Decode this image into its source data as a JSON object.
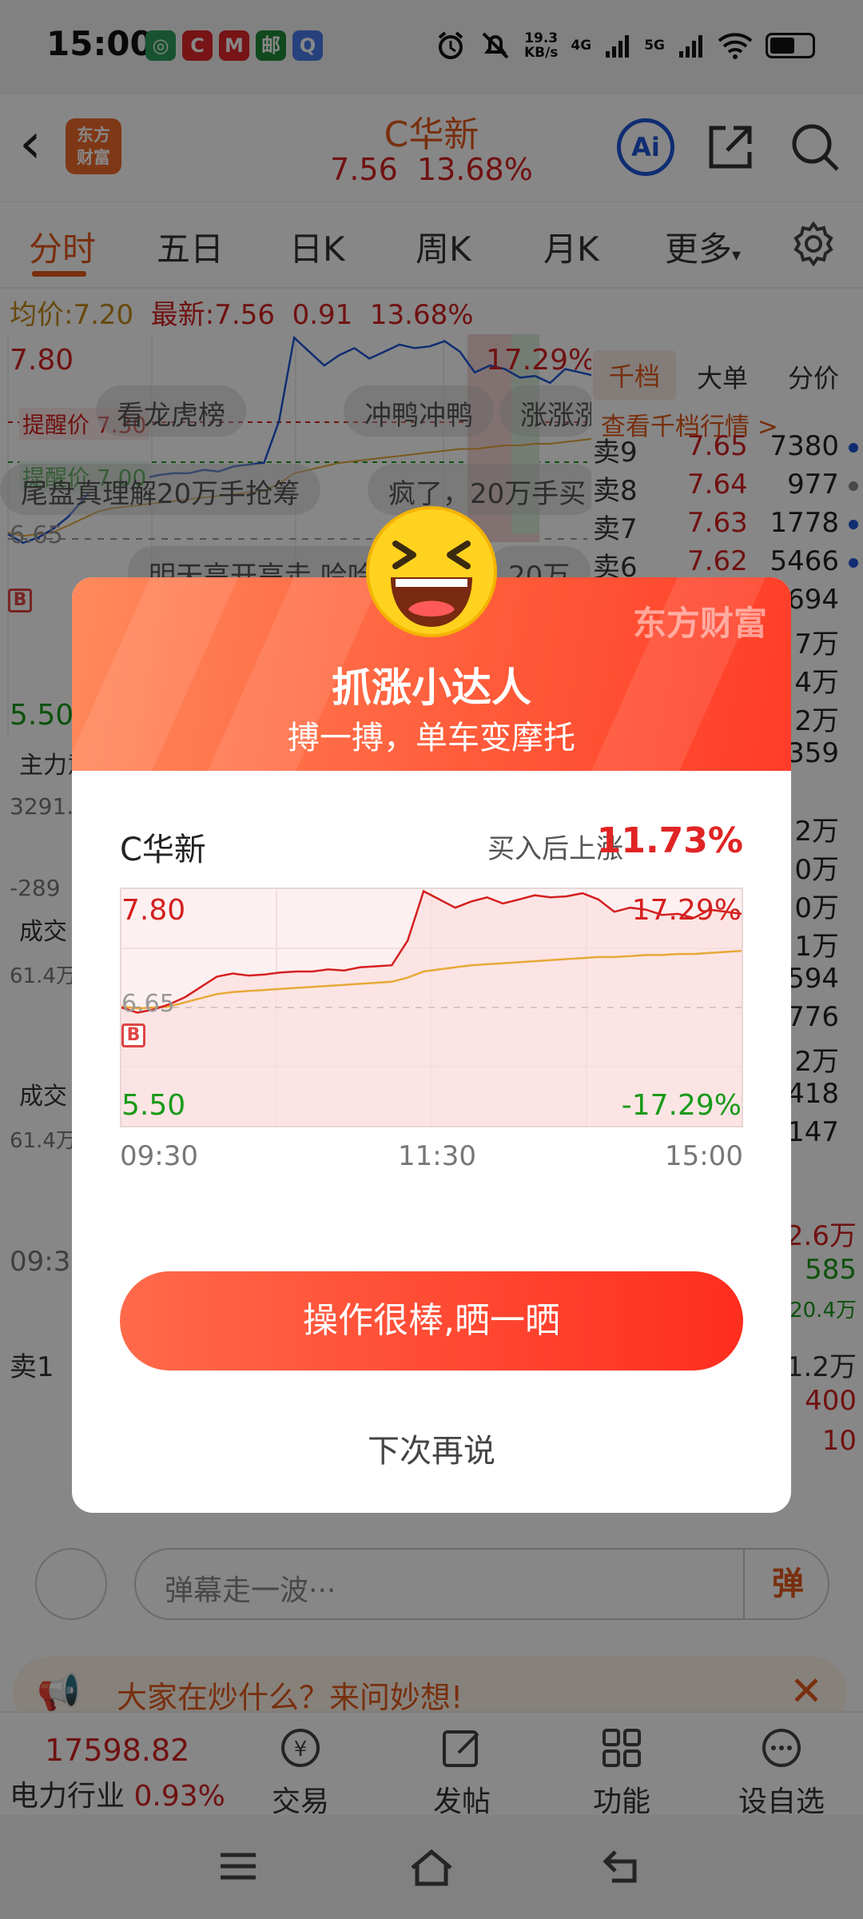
{
  "status_bar": {
    "time": "15:00",
    "net_speed_value": "19.3",
    "net_speed_unit": "KB/s",
    "signal_1": "4G",
    "signal_2": "5G"
  },
  "header": {
    "logo_text_1": "东方",
    "logo_text_2": "财富",
    "stock_name": "C华新",
    "price": "7.56",
    "change_pct": "13.68%",
    "ai_label": "Ai"
  },
  "tabs": [
    "分时",
    "五日",
    "日K",
    "周K",
    "月K",
    "更多"
  ],
  "info_line": {
    "avg_label": "均价:",
    "avg_value": "7.20",
    "latest_label": "最新:",
    "latest_value": "7.56",
    "change_value": "0.91",
    "change_pct": "13.68%"
  },
  "background_chart": {
    "top_price": "7.80",
    "top_pct": "17.29%",
    "low_price": "5.50",
    "ref_price": "6.65",
    "alert_1": "提醒价 7.30",
    "alert_2": "提醒价 7.00",
    "barrage_1": "看龙虎榜",
    "barrage_2": "冲鸭冲鸭",
    "barrage_3": "涨涨涨",
    "barrage_4": "尾盘真理解20万手抢筹",
    "barrage_5": "疯了，20万手买",
    "barrage_6": "明天高开高走 哈哈",
    "barrage_7": "20万",
    "b_marker": "B",
    "main_label": "主力意",
    "main_val": "3291.",
    "main_neg": "-289",
    "vol_label_1": "成交",
    "vol_val_1": "61.4万",
    "vol_label_2": "成交",
    "vol_val_2": "61.4万",
    "time_start": "09:3",
    "sell1": "卖1"
  },
  "order_book": {
    "tabs": [
      "千档",
      "大单",
      "分价"
    ],
    "link": "查看千档行情 >",
    "rows": [
      {
        "label": "卖9",
        "price": "7.65",
        "vol": "7380",
        "dot": "#1f55d8"
      },
      {
        "label": "卖8",
        "price": "7.64",
        "vol": "977",
        "dot": "#888888"
      },
      {
        "label": "卖7",
        "price": "7.63",
        "vol": "1778",
        "dot": "#1f55d8"
      },
      {
        "label": "卖6",
        "price": "7.62",
        "vol": "5466",
        "dot": "#1f55d8"
      }
    ],
    "right_col": [
      "694",
      "7万",
      "4万",
      "2万",
      "359",
      "2万",
      "0万",
      "0万",
      "1万",
      "594",
      "776",
      "2万",
      "418",
      "147"
    ],
    "lower_vals": [
      "2.6万",
      "585",
      "20.4万",
      "1.2万",
      "400",
      "10"
    ]
  },
  "danmu": {
    "placeholder": "弹幕走一波···",
    "send": "弹"
  },
  "ask_bar": {
    "text": "大家在炒什么？来问妙想!"
  },
  "bottom_nav": {
    "index_value": "17598.82",
    "index_name": "电力行业",
    "index_pct": "0.93%",
    "items": [
      "交易",
      "发帖",
      "功能",
      "设自选"
    ]
  },
  "dialog": {
    "brand": "东方财富",
    "title": "抓涨小达人",
    "subtitle": "搏一搏，单车变摩托",
    "stock_name": "C华新",
    "rise_label": "买入后上涨",
    "rise_value": "11.73%",
    "chart": {
      "top_price": "7.80",
      "top_pct": "17.29%",
      "ref_price": "6.65",
      "low_price": "5.50",
      "low_pct": "-17.29%",
      "b_marker": "B",
      "time_labels": [
        "09:30",
        "11:30",
        "15:00"
      ]
    },
    "share_button": "操作很棒,晒一晒",
    "later_button": "下次再说"
  },
  "colors": {
    "brand_orange": "#e35a1b",
    "up_red": "#d42020",
    "down_green": "#1a9a1a",
    "avg_yellow": "#e8a838"
  },
  "chart_data": {
    "type": "line",
    "x_range": [
      "09:30",
      "15:00"
    ],
    "ylim": [
      5.5,
      7.8
    ],
    "reference": 6.65,
    "series": [
      {
        "values": [
          6.65,
          6.6,
          6.63,
          6.68,
          6.75,
          6.85,
          6.95,
          6.98,
          6.96,
          6.97,
          6.99,
          7.0,
          7.0,
          7.02,
          7.01,
          7.04,
          7.05,
          7.06,
          7.3,
          7.78,
          7.7,
          7.62,
          7.68,
          7.72,
          7.66,
          7.7,
          7.74,
          7.72,
          7.73,
          7.76,
          7.7,
          7.58,
          7.62,
          7.6,
          7.55,
          7.56,
          7.52,
          7.6,
          7.58,
          7.56
        ]
      },
      {
        "values": [
          6.66,
          6.64,
          6.65,
          6.66,
          6.7,
          6.74,
          6.78,
          6.8,
          6.81,
          6.82,
          6.83,
          6.84,
          6.85,
          6.86,
          6.87,
          6.88,
          6.89,
          6.9,
          6.94,
          7.0,
          7.02,
          7.04,
          7.06,
          7.07,
          7.08,
          7.09,
          7.1,
          7.11,
          7.12,
          7.13,
          7.14,
          7.14,
          7.15,
          7.16,
          7.16,
          7.17,
          7.17,
          7.18,
          7.19,
          7.2
        ]
      }
    ]
  }
}
